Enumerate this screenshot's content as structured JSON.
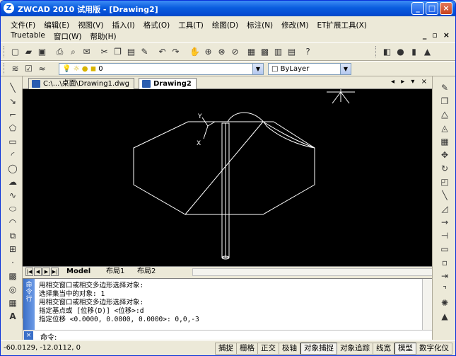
{
  "window": {
    "title": "ZWCAD 2010 试用版 - [Drawing2]",
    "min": "_",
    "max": "□",
    "close": "×"
  },
  "menu": {
    "row1": [
      "文件(F)",
      "编辑(E)",
      "视图(V)",
      "插入(I)",
      "格式(O)",
      "工具(T)",
      "绘图(D)",
      "标注(N)",
      "修改(M)",
      "ET扩展工具(X)"
    ],
    "row2": [
      "Truetable",
      "窗口(W)",
      "帮助(H)"
    ],
    "mdi_min": "_",
    "mdi_max": "▫",
    "mdi_close": "×"
  },
  "toolbar": {
    "icons": [
      "new-icon",
      "open-icon",
      "save-icon",
      "print-icon",
      "preview-icon",
      "publish-icon",
      "cut-icon",
      "copy-icon",
      "paste-icon",
      "matchprop-icon",
      "undo-icon",
      "redo-icon",
      "pan-icon",
      "zoom-realtime-icon",
      "zoom-window-icon",
      "zoom-previous-icon",
      "properties-icon",
      "designcenter-icon",
      "toolpalette-icon",
      "calculator-icon",
      "help-icon",
      "box-icon",
      "sphere-icon",
      "cylinder-icon",
      "cone-icon"
    ],
    "layer_value": "0",
    "color_value": "ByLayer"
  },
  "tabs": [
    {
      "label": "C:\\...\\桌面\\Drawing1.dwg",
      "active": false
    },
    {
      "label": "Drawing2",
      "active": true
    }
  ],
  "tabnav": "◂ ▸ ▾ ×",
  "layout_tabs": [
    "Model",
    "布局1",
    "布局2"
  ],
  "command": {
    "side_label": "命令行",
    "history": [
      "用相交窗口或相交多边形选择对象:",
      "选择集当中的对象: 1",
      "用相交窗口或相交多边形选择对象:",
      "指定基点或 [位移(D)] <位移>:d",
      "指定位移 <0.0000, 0.0000, 0.0000>: 0,0,-3"
    ],
    "prompt": "命令:"
  },
  "status": {
    "coords": "-60.0129,  -12.0112,  0",
    "buttons": [
      {
        "label": "捕捉",
        "on": false
      },
      {
        "label": "栅格",
        "on": false
      },
      {
        "label": "正交",
        "on": false
      },
      {
        "label": "极轴",
        "on": false
      },
      {
        "label": "对象捕捉",
        "on": true
      },
      {
        "label": "对象追踪",
        "on": false
      },
      {
        "label": "线宽",
        "on": false
      },
      {
        "label": "模型",
        "on": true
      },
      {
        "label": "数字化仪",
        "on": false
      }
    ]
  },
  "ucs": {
    "x": "X",
    "y": "Y"
  },
  "colors": {
    "canvas": "#000000",
    "geometry": "#ffffff",
    "title": "#0a5ddf"
  }
}
